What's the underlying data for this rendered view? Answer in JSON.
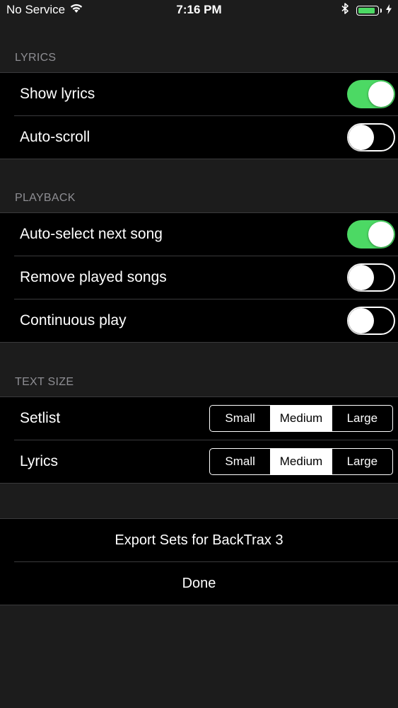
{
  "status_bar": {
    "carrier": "No Service",
    "time": "7:16 PM",
    "battery_level": 0.9,
    "wifi_icon": "wifi-icon",
    "bluetooth_icon": "bluetooth-icon",
    "charging_icon": "charging-bolt-icon"
  },
  "lyrics": {
    "header": "LYRICS",
    "show_lyrics": {
      "label": "Show lyrics",
      "on": true
    },
    "auto_scroll": {
      "label": "Auto-scroll",
      "on": false
    }
  },
  "playback": {
    "header": "PLAYBACK",
    "auto_select": {
      "label": "Auto-select next song",
      "on": true
    },
    "remove_played": {
      "label": "Remove played songs",
      "on": false
    },
    "continuous": {
      "label": "Continuous play",
      "on": false
    }
  },
  "text_size": {
    "header": "TEXT SIZE",
    "options": [
      "Small",
      "Medium",
      "Large"
    ],
    "setlist": {
      "label": "Setlist",
      "selected": "Medium"
    },
    "lyrics": {
      "label": "Lyrics",
      "selected": "Medium"
    }
  },
  "actions": {
    "export": "Export Sets for BackTrax 3",
    "done": "Done"
  },
  "colors": {
    "background": "#1c1c1c",
    "group_background": "#000000",
    "toggle_on": "#4cd964",
    "header_text": "#8e8e93"
  }
}
